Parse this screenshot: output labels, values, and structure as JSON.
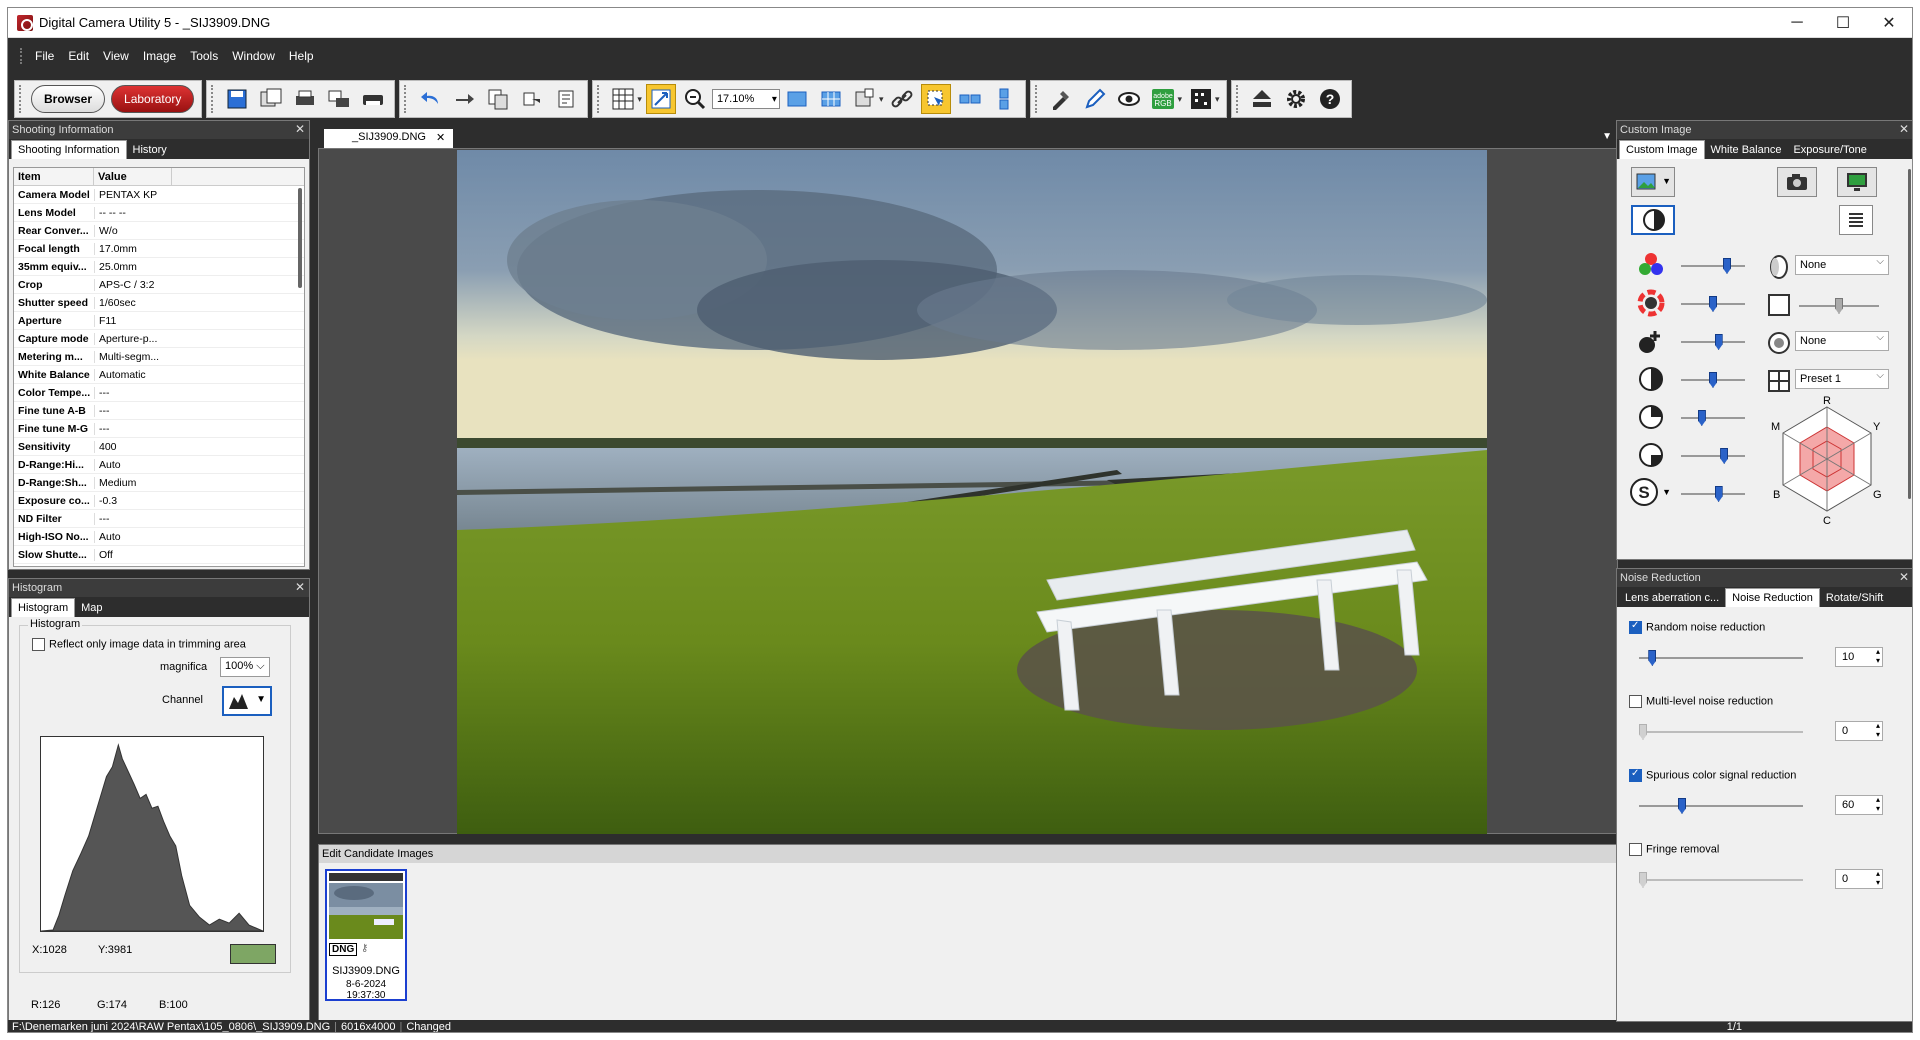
{
  "window": {
    "title": "Digital Camera Utility 5 - _SIJ3909.DNG",
    "minimize": "─",
    "maximize": "☐",
    "close": "✕"
  },
  "menu": [
    "File",
    "Edit",
    "View",
    "Image",
    "Tools",
    "Window",
    "Help"
  ],
  "toolbar": {
    "browser": "Browser",
    "laboratory": "Laboratory",
    "zoom": "17.10%"
  },
  "shooting_panel": {
    "title": "Shooting Information",
    "tabs": [
      "Shooting Information",
      "History"
    ],
    "col_item": "Item",
    "col_value": "Value",
    "rows": [
      {
        "k": "Camera Model",
        "v": "PENTAX KP"
      },
      {
        "k": "Lens Model",
        "v": "-- -- --"
      },
      {
        "k": "Rear Conver...",
        "v": "W/o"
      },
      {
        "k": "Focal length",
        "v": "17.0mm"
      },
      {
        "k": "35mm equiv...",
        "v": "25.0mm"
      },
      {
        "k": "Crop",
        "v": "APS-C / 3:2"
      },
      {
        "k": "Shutter speed",
        "v": "1/60sec"
      },
      {
        "k": "Aperture",
        "v": "F11"
      },
      {
        "k": "Capture mode",
        "v": "Aperture-p..."
      },
      {
        "k": "Metering m...",
        "v": "Multi-segm..."
      },
      {
        "k": "White Balance",
        "v": "Automatic"
      },
      {
        "k": "Color Tempe...",
        "v": "---"
      },
      {
        "k": "Fine tune A-B",
        "v": "---"
      },
      {
        "k": "Fine tune M-G",
        "v": "---"
      },
      {
        "k": "Sensitivity",
        "v": "400"
      },
      {
        "k": "D-Range:Hi...",
        "v": "Auto"
      },
      {
        "k": "D-Range:Sh...",
        "v": "Medium"
      },
      {
        "k": "Exposure co...",
        "v": "-0.3"
      },
      {
        "k": "ND Filter",
        "v": "---"
      },
      {
        "k": "High-ISO No...",
        "v": "Auto"
      },
      {
        "k": "Slow Shutte...",
        "v": "Off"
      }
    ]
  },
  "histogram_panel": {
    "title": "Histogram",
    "tabs": [
      "Histogram",
      "Map"
    ],
    "group": "Histogram",
    "reflect": "Reflect only image data in trimming area",
    "magnifica_label": "magnifica",
    "magnifica_value": "100%",
    "channel_label": "Channel",
    "x": "X:1028",
    "y": "Y:3981",
    "r": "R:126",
    "g": "G:174",
    "b": "B:100",
    "swatch": "#7ea664"
  },
  "document": {
    "tab": "_SIJ3909.DNG",
    "close": "✕"
  },
  "candidates": {
    "title": "Edit Candidate Images",
    "badge": "DNG",
    "filename": "SIJ3909.DNG",
    "date": "8-6-2024 19:37:30"
  },
  "status": {
    "path": "F:\\Denemarken juni 2024\\RAW Pentax\\105_0806\\_SIJ3909.DNG",
    "size": "6016x4000",
    "state": "Changed",
    "page": "1/1"
  },
  "custom_image_panel": {
    "title": "Custom Image",
    "tabs": [
      "Custom Image",
      "White Balance",
      "Exposure/Tone"
    ],
    "sel1": "None",
    "sel2": "None",
    "sel3": "Preset 1",
    "radar": {
      "r": "R",
      "y": "Y",
      "g": "G",
      "c": "C",
      "b": "B",
      "m": "M"
    },
    "sliders": [
      0.75,
      0.5,
      0.6,
      0.5,
      0.3,
      0.7,
      0.6
    ]
  },
  "noise_panel": {
    "title": "Noise Reduction",
    "tabs": [
      "Lens aberration c...",
      "Noise Reduction",
      "Rotate/Shift"
    ],
    "items": [
      {
        "label": "Random noise reduction",
        "checked": true,
        "value": "10",
        "pos": 0.06
      },
      {
        "label": "Multi-level noise reduction",
        "checked": false,
        "value": "0",
        "pos": 0.0
      },
      {
        "label": "Spurious color signal reduction",
        "checked": true,
        "value": "60",
        "pos": 0.25
      },
      {
        "label": "Fringe removal",
        "checked": false,
        "value": "0",
        "pos": 0.0
      }
    ]
  }
}
